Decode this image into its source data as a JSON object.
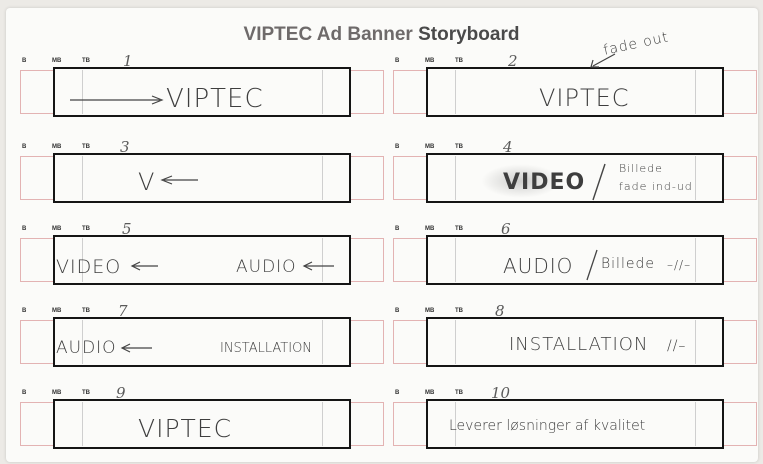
{
  "title": {
    "main": "VIPTEC Ad Banner",
    "rest": "Storyboard"
  },
  "guides": {
    "b": "B",
    "mb": "MB",
    "tb": "TB"
  },
  "frames": [
    {
      "num": "1",
      "text": "VIPTEC",
      "note": ""
    },
    {
      "num": "2",
      "text": "VIPTEC",
      "note": "fade out"
    },
    {
      "num": "3",
      "text": "V",
      "note": ""
    },
    {
      "num": "4",
      "text": "VIDEO",
      "note_line1": "Billede",
      "note_line2": "fade ind-ud"
    },
    {
      "num": "5",
      "text_left": "VIDEO",
      "text_right": "AUDIO"
    },
    {
      "num": "6",
      "text": "AUDIO",
      "note": "Billede",
      "mark": "–//–"
    },
    {
      "num": "7",
      "text_left": "AUDIO",
      "text_right": "INSTALLATION"
    },
    {
      "num": "8",
      "text": "INSTALLATION",
      "mark": "//–"
    },
    {
      "num": "9",
      "text": "VIPTEC"
    },
    {
      "num": "10",
      "text": "Leverer løsninger af kvalitet"
    }
  ]
}
